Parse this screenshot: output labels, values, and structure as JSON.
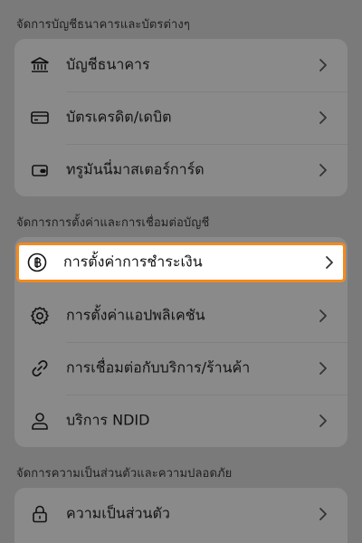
{
  "sections": [
    {
      "title": "จัดการบัญชีธนาคารและบัตรต่างๆ",
      "items": [
        {
          "label": "บัญชีธนาคาร",
          "icon": "bank-icon"
        },
        {
          "label": "บัตรเครดิต/เดบิต",
          "icon": "credit-card-icon"
        },
        {
          "label": "ทรูมันนี่มาสเตอร์การ์ด",
          "icon": "wallet-card-icon"
        }
      ]
    },
    {
      "title": "จัดการการตั้งค่าและการเชื่อมต่อบัญชี",
      "items": [
        {
          "label": "การตั้งค่าการชำระเงิน",
          "icon": "baht-icon"
        },
        {
          "label": "การตั้งค่าแอปพลิเคชัน",
          "icon": "gear-icon"
        },
        {
          "label": "การเชื่อมต่อกับบริการ/ร้านค้า",
          "icon": "link-icon"
        },
        {
          "label": "บริการ NDID",
          "icon": "person-icon"
        }
      ]
    },
    {
      "title": "จัดการความเป็นส่วนตัวและความปลอดภัย",
      "items": [
        {
          "label": "ความเป็นส่วนตัว",
          "icon": "lock-icon"
        }
      ]
    }
  ],
  "highlight_color": "#f28a1e",
  "chevron": "chevron-right-icon"
}
